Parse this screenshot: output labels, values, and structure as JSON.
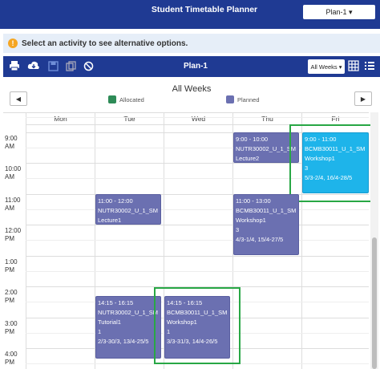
{
  "header": {
    "title": "Student Timetable Planner",
    "plan_selector": "Plan-1 ▾"
  },
  "banner": {
    "text": "Select an activity to see alternative options."
  },
  "toolbar": {
    "plan_name": "Plan-1",
    "weeks_select": "All Weeks ▾"
  },
  "week_view": {
    "title": "All Weeks",
    "legend": [
      {
        "label": "Allocated",
        "color": "#2e8b57"
      },
      {
        "label": "Planned",
        "color": "#6b70b1"
      }
    ],
    "prev": "◀",
    "next": "▶"
  },
  "days": [
    "Mon",
    "Tue",
    "Wed",
    "Thu",
    "Fri"
  ],
  "times": [
    {
      "hour": "9:00",
      "ampm": "AM"
    },
    {
      "hour": "10:00",
      "ampm": "AM"
    },
    {
      "hour": "11:00",
      "ampm": "AM"
    },
    {
      "hour": "12:00",
      "ampm": "PM"
    },
    {
      "hour": "1:00",
      "ampm": "PM"
    },
    {
      "hour": "2:00",
      "ampm": "PM"
    },
    {
      "hour": "3:00",
      "ampm": "PM"
    },
    {
      "hour": "4:00",
      "ampm": "PM"
    }
  ],
  "events": [
    {
      "time": "9:00 - 10:00",
      "code": "NUTR30002_U_1_SM",
      "type": "Lecture2"
    },
    {
      "time": "9:00 - 11:00",
      "code": "BCMB30011_U_1_SM",
      "type": "Workshop1",
      "group": "3",
      "weeks": "5/3-2/4, 16/4-28/5"
    },
    {
      "time": "11:00 - 12:00",
      "code": "NUTR30002_U_1_SM",
      "type": "Lecture1"
    },
    {
      "time": "11:00 - 13:00",
      "code": "BCMB30011_U_1_SM",
      "type": "Workshop1",
      "group": "3",
      "weeks": "4/3-1/4, 15/4-27/5"
    },
    {
      "time": "14:15 - 16:15",
      "code": "NUTR30002_U_1_SM",
      "type": "Tutorial1",
      "group": "1",
      "weeks": "2/3-30/3, 13/4-25/5"
    },
    {
      "time": "14:15 - 16:15",
      "code": "BCMB30011_U_1_SM",
      "type": "Workshop1",
      "group": "1",
      "weeks": "3/3-31/3, 14/4-26/5"
    }
  ],
  "colors": {
    "header": "#1f3a93",
    "planned": "#6b70b1",
    "selected": "#1eb4ea",
    "highlight": "#28a745"
  }
}
